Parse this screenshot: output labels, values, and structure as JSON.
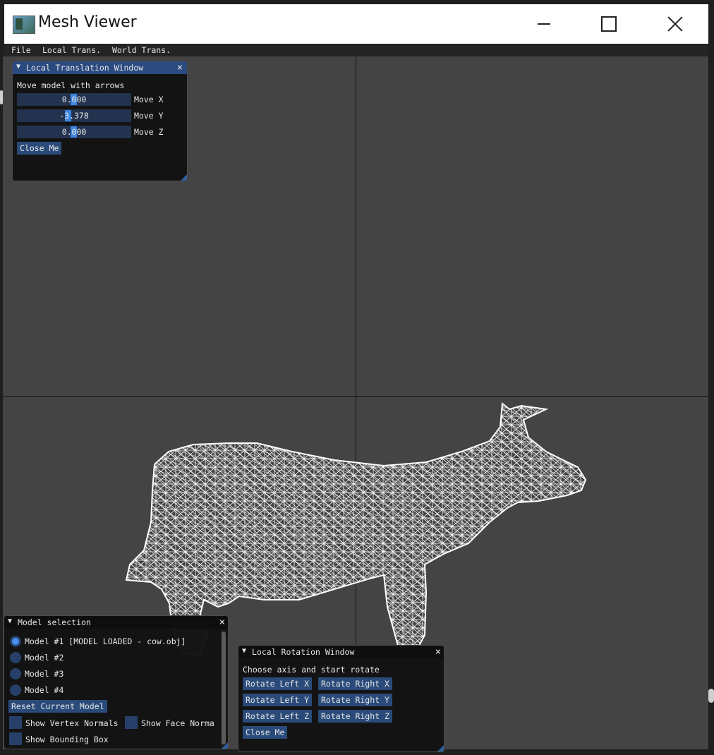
{
  "window": {
    "title": "Mesh Viewer",
    "icon": "app-icon"
  },
  "menu": {
    "items": [
      "File",
      "Local Trans.",
      "World Trans."
    ]
  },
  "translation_window": {
    "title": "Local Translation Window",
    "close_glyph": "×",
    "collapse_glyph": "▼",
    "hint": "Move model with arrows",
    "sliders": [
      {
        "value": "0.000",
        "label": "Move X"
      },
      {
        "value": "-3.378",
        "label": "Move Y"
      },
      {
        "value": "0.000",
        "label": "Move Z"
      }
    ],
    "close_button": "Close Me"
  },
  "model_window": {
    "title": "Model selection",
    "close_glyph": "×",
    "collapse_glyph": "▼",
    "models": [
      {
        "label": "Model #1 [MODEL LOADED - cow.obj]",
        "selected": true
      },
      {
        "label": "Model #2",
        "selected": false
      },
      {
        "label": "Model #3",
        "selected": false
      },
      {
        "label": "Model #4",
        "selected": false
      }
    ],
    "reset_button": "Reset Current Model",
    "checks": [
      "Show Vertex Normals",
      "Show Face Norma",
      "Show Bounding Box"
    ]
  },
  "rotation_window": {
    "title": "Local Rotation Window",
    "close_glyph": "×",
    "collapse_glyph": "▼",
    "hint": "Choose axis and start rotate",
    "buttons": [
      [
        "Rotate Left X",
        "Rotate Right X"
      ],
      [
        "Rotate Left Y",
        "Rotate Right Y"
      ],
      [
        "Rotate Left Z",
        "Rotate Right Z"
      ]
    ],
    "close_button": "Close Me"
  },
  "colors": {
    "viewport": "#444444",
    "widget_bg": "#121212",
    "accent": "#2a4b7a",
    "slider_grab": "#3d85e0"
  }
}
